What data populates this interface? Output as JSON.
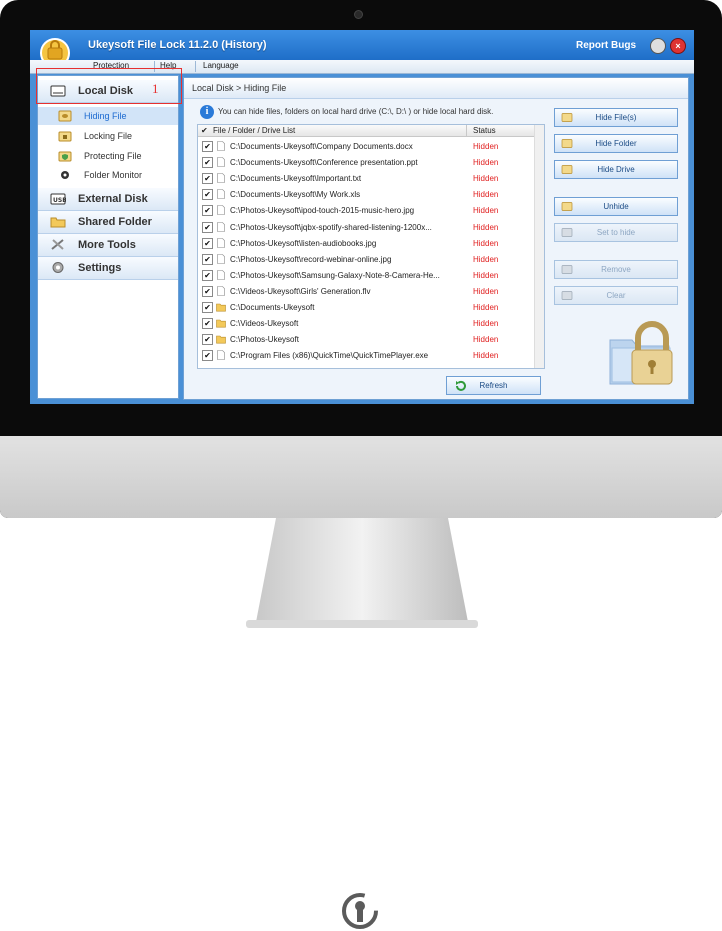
{
  "window": {
    "title": "Ukeysoft File Lock 11.2.0 (History)",
    "report_bugs": "Report Bugs"
  },
  "menu": [
    "Protection",
    "Help",
    "Language"
  ],
  "sidebar": {
    "sections": [
      {
        "label": "Local Disk",
        "icon": "hard-disk-icon"
      },
      {
        "label": "External Disk",
        "icon": "usb-drive-icon"
      },
      {
        "label": "Shared Folder",
        "icon": "shared-folder-icon"
      },
      {
        "label": "More Tools",
        "icon": "tools-icon"
      },
      {
        "label": "Settings",
        "icon": "gear-icon"
      }
    ],
    "local_disk_items": [
      {
        "label": "Hiding File",
        "icon": "hide-file-icon",
        "active": true
      },
      {
        "label": "Locking File",
        "icon": "lock-file-icon"
      },
      {
        "label": "Protecting File",
        "icon": "protect-file-icon"
      },
      {
        "label": "Folder Monitor",
        "icon": "monitor-icon"
      }
    ],
    "callout_number": "1"
  },
  "main": {
    "breadcrumb": "Local Disk > Hiding File",
    "info_text": "You can hide files, folders on local hard drive (C:\\, D:\\ ) or hide local hard disk.",
    "table": {
      "columns": [
        "File / Folder / Drive List",
        "Status"
      ],
      "rows": [
        {
          "path": "C:\\Documents-Ukeysoft\\Company Documents.docx",
          "type": "file",
          "status": "Hidden"
        },
        {
          "path": "C:\\Documents-Ukeysoft\\Conference presentation.ppt",
          "type": "file",
          "status": "Hidden"
        },
        {
          "path": "C:\\Documents-Ukeysoft\\Important.txt",
          "type": "file",
          "status": "Hidden"
        },
        {
          "path": "C:\\Documents-Ukeysoft\\My Work.xls",
          "type": "file",
          "status": "Hidden"
        },
        {
          "path": "C:\\Photos-Ukeysoft\\ipod-touch-2015-music-hero.jpg",
          "type": "file",
          "status": "Hidden"
        },
        {
          "path": "C:\\Photos-Ukeysoft\\jqbx-spotify-shared-listening-1200x...",
          "type": "file",
          "status": "Hidden"
        },
        {
          "path": "C:\\Photos-Ukeysoft\\listen-audiobooks.jpg",
          "type": "file",
          "status": "Hidden"
        },
        {
          "path": "C:\\Photos-Ukeysoft\\record-webinar-online.jpg",
          "type": "file",
          "status": "Hidden"
        },
        {
          "path": "C:\\Photos-Ukeysoft\\Samsung-Galaxy-Note-8-Camera-He...",
          "type": "file",
          "status": "Hidden"
        },
        {
          "path": "C:\\Videos-Ukeysoft\\Girls' Generation.flv",
          "type": "file",
          "status": "Hidden"
        },
        {
          "path": "C:\\Documents-Ukeysoft",
          "type": "folder",
          "status": "Hidden"
        },
        {
          "path": "C:\\Videos-Ukeysoft",
          "type": "folder",
          "status": "Hidden"
        },
        {
          "path": "C:\\Photos-Ukeysoft",
          "type": "folder",
          "status": "Hidden"
        },
        {
          "path": "C:\\Program Files (x86)\\QuickTime\\QuickTimePlayer.exe",
          "type": "file",
          "status": "Hidden"
        }
      ]
    },
    "actions": [
      {
        "label": "Hide File(s)",
        "icon": "hide-file-icon",
        "enabled": true
      },
      {
        "label": "Hide Folder",
        "icon": "folder-icon",
        "enabled": true
      },
      {
        "label": "Hide Drive",
        "icon": "drive-icon",
        "enabled": true
      },
      {
        "label": "Unhide",
        "icon": "unhide-icon",
        "enabled": true
      },
      {
        "label": "Set to hide",
        "icon": "set-hide-icon",
        "enabled": false
      },
      {
        "label": "Remove",
        "icon": "remove-icon",
        "enabled": false
      },
      {
        "label": "Clear",
        "icon": "clear-icon",
        "enabled": false
      }
    ],
    "refresh_label": "Refresh"
  },
  "colors": {
    "title_bar": "#1f6ec8",
    "status_hidden": "#e02020",
    "callout": "#e63030",
    "active_item": "#d2e4f8"
  }
}
